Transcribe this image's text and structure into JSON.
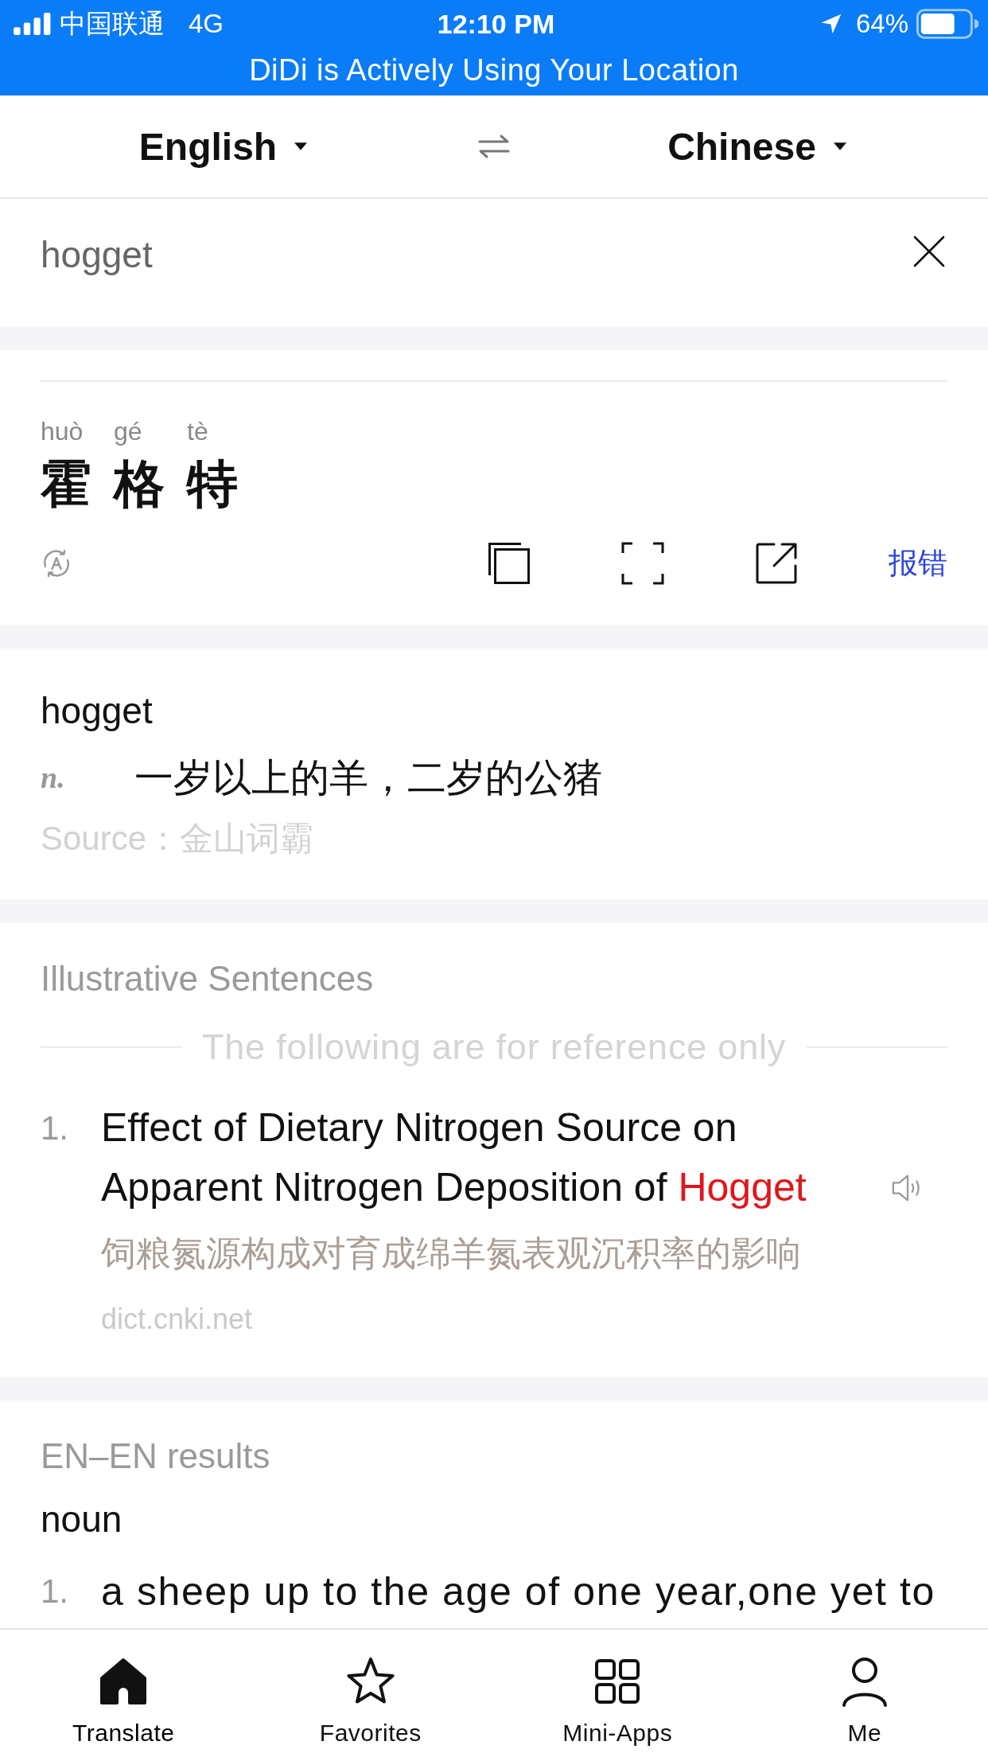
{
  "status_bar": {
    "carrier": "中国联通",
    "network": "4G",
    "time": "12:10 PM",
    "battery_percent": "64%",
    "banner": "DiDi is Actively Using Your Location"
  },
  "language_bar": {
    "source": "English",
    "target": "Chinese"
  },
  "input": {
    "value": "hogget"
  },
  "translation": {
    "syllables": [
      {
        "pinyin": "huò",
        "hanzi": "霍"
      },
      {
        "pinyin": "gé",
        "hanzi": "格"
      },
      {
        "pinyin": "tè",
        "hanzi": "特"
      }
    ],
    "report_link": "报错"
  },
  "dictionary": {
    "headword": "hogget",
    "entries": [
      {
        "pos": "n.",
        "definition": "一岁以上的羊，二岁的公猪"
      }
    ],
    "source": "Source：金山词霸"
  },
  "sentences": {
    "title": "Illustrative Sentences",
    "notice": "The following are for reference only",
    "items": [
      {
        "number": "1.",
        "segments": [
          {
            "text": "Effect of Dietary Nitrogen Source on Apparent Nitrogen Deposition of ",
            "highlight": false
          },
          {
            "text": "Hogget",
            "highlight": true
          }
        ],
        "translation": "饲粮氮源构成对育成绵羊氮表观沉积率的影响",
        "source": "dict.cnki.net"
      }
    ]
  },
  "en_en": {
    "title": "EN–EN results",
    "pos": "noun",
    "definitions": [
      {
        "number": "1.",
        "text": "a sheep up to the age of one year,one yet to"
      }
    ]
  },
  "tab_bar": [
    {
      "label": "Translate",
      "selected": true
    },
    {
      "label": "Favorites",
      "selected": false
    },
    {
      "label": "Mini-Apps",
      "selected": false
    },
    {
      "label": "Me",
      "selected": false
    }
  ]
}
